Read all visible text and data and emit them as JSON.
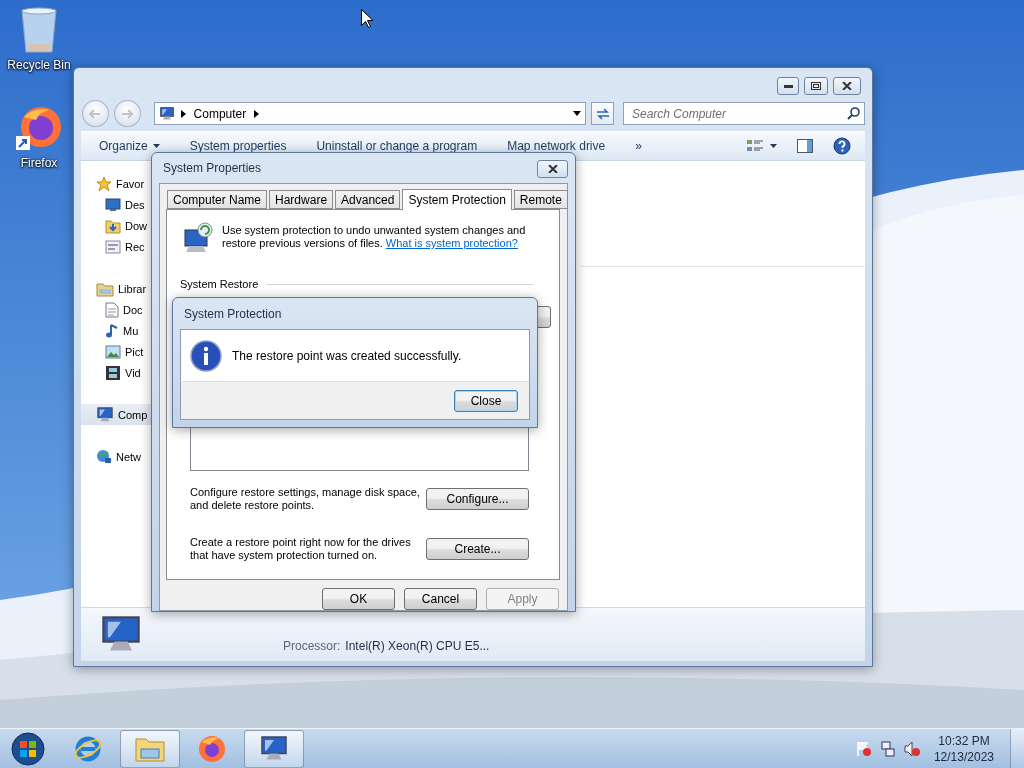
{
  "desktop": {
    "icons": [
      {
        "kind": "recycle-bin",
        "label": "Recycle Bin"
      },
      {
        "kind": "firefox",
        "label": "Firefox"
      }
    ]
  },
  "explorer": {
    "address": {
      "crumbs": [
        "Computer"
      ]
    },
    "search": {
      "placeholder": "Search Computer"
    },
    "commands": [
      {
        "label": "Organize",
        "menu": true
      },
      {
        "label": "System properties",
        "menu": false
      },
      {
        "label": "Uninstall or change a program",
        "menu": false
      },
      {
        "label": "Map network drive",
        "menu": false
      }
    ],
    "more": "»",
    "sidebar": {
      "items": [
        {
          "kind": "favorites",
          "label": "Favor",
          "selected": false,
          "children": [
            {
              "kind": "desktop",
              "label": "Des",
              "selected": false
            },
            {
              "kind": "downloads",
              "label": "Dow",
              "selected": false
            },
            {
              "kind": "recent",
              "label": "Rec",
              "selected": false
            }
          ]
        },
        {
          "kind": "libraries",
          "label": "Librar",
          "selected": false,
          "children": [
            {
              "kind": "documents",
              "label": "Doc",
              "selected": false
            },
            {
              "kind": "music",
              "label": "Mu",
              "selected": false
            },
            {
              "kind": "pictures",
              "label": "Pict",
              "selected": false
            },
            {
              "kind": "videos",
              "label": "Vid",
              "selected": false
            }
          ]
        },
        {
          "kind": "computer",
          "label": "Comp",
          "selected": true
        },
        {
          "kind": "network",
          "label": "Netw",
          "selected": false
        }
      ]
    },
    "details": {
      "processor_label": "Processor:",
      "processor": "Intel(R) Xeon(R) CPU E5..."
    }
  },
  "system_properties": {
    "title": "System Properties",
    "tabs": [
      {
        "label": "Computer Name",
        "selected": false
      },
      {
        "label": "Hardware",
        "selected": false
      },
      {
        "label": "Advanced",
        "selected": false
      },
      {
        "label": "System Protection",
        "selected": true
      },
      {
        "label": "Remote",
        "selected": false
      }
    ],
    "intro": "Use system protection to undo unwanted system changes and restore previous versions of files.",
    "intro_link": "What is system protection?",
    "restore_heading": "System Restore",
    "configure_text": "Configure restore settings, manage disk space, and delete restore points.",
    "configure_button": "Configure...",
    "create_text": "Create a restore point right now for the drives that have system protection turned on.",
    "create_button": "Create...",
    "buttons": [
      {
        "label": "OK",
        "disabled": false
      },
      {
        "label": "Cancel",
        "disabled": false
      },
      {
        "label": "Apply",
        "disabled": true
      }
    ]
  },
  "message_box": {
    "title": "System Protection",
    "message": "The restore point was created successfully.",
    "button": {
      "label": "Close",
      "default": true
    }
  },
  "taskbar": {
    "buttons": [
      {
        "kind": "start",
        "active": false
      },
      {
        "kind": "internet-explorer",
        "active": false
      },
      {
        "kind": "file-explorer",
        "active": true
      },
      {
        "kind": "firefox",
        "active": false
      },
      {
        "kind": "system-properties",
        "active": true
      }
    ],
    "tray": [
      {
        "kind": "action-center"
      },
      {
        "kind": "network"
      },
      {
        "kind": "volume-muted"
      }
    ],
    "time": "10:32 PM",
    "date": "12/13/2023"
  }
}
